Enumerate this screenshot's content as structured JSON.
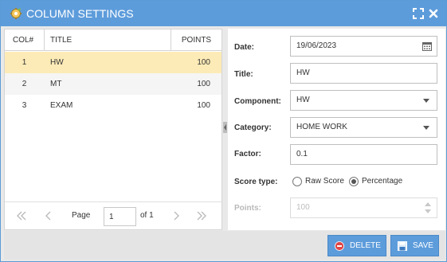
{
  "window": {
    "title": "COLUMN SETTINGS",
    "icons": {
      "title": "gear-icon",
      "maximize": "maximize-icon",
      "close": "close-icon"
    }
  },
  "grid": {
    "columns": {
      "col": "COL#",
      "title": "TITLE",
      "points": "POINTS"
    },
    "rows": [
      {
        "col": "1",
        "title": "HW",
        "points": "100",
        "selected": true
      },
      {
        "col": "2",
        "title": "MT",
        "points": "100",
        "selected": false
      },
      {
        "col": "3",
        "title": "EXAM",
        "points": "100",
        "selected": false
      }
    ],
    "pager": {
      "page_label": "Page",
      "page_value": "1",
      "of_label": "of 1",
      "icons": [
        "first-page-icon",
        "prev-page-icon",
        "next-page-icon",
        "last-page-icon"
      ]
    }
  },
  "form": {
    "date": {
      "label": "Date:",
      "value": "19/06/2023",
      "icon": "calendar-icon"
    },
    "title": {
      "label": "Title:",
      "value": "HW"
    },
    "component": {
      "label": "Component:",
      "value": "HW"
    },
    "category": {
      "label": "Category:",
      "value": "HOME WORK"
    },
    "factor": {
      "label": "Factor:",
      "value": "0.1"
    },
    "score_type": {
      "label": "Score type:",
      "options": [
        "Raw Score",
        "Percentage"
      ],
      "selected": "Percentage"
    },
    "points": {
      "label": "Points:",
      "value": "100",
      "disabled": true
    }
  },
  "footer": {
    "delete_label": "DELETE",
    "save_label": "SAVE",
    "delete_icon": "delete-icon",
    "save_icon": "save-icon"
  },
  "colors": {
    "titlebar": "#5d9cdb",
    "selected_row": "#fdebb7",
    "button": "#5d9cdb",
    "delete_icon": "#e04545"
  }
}
